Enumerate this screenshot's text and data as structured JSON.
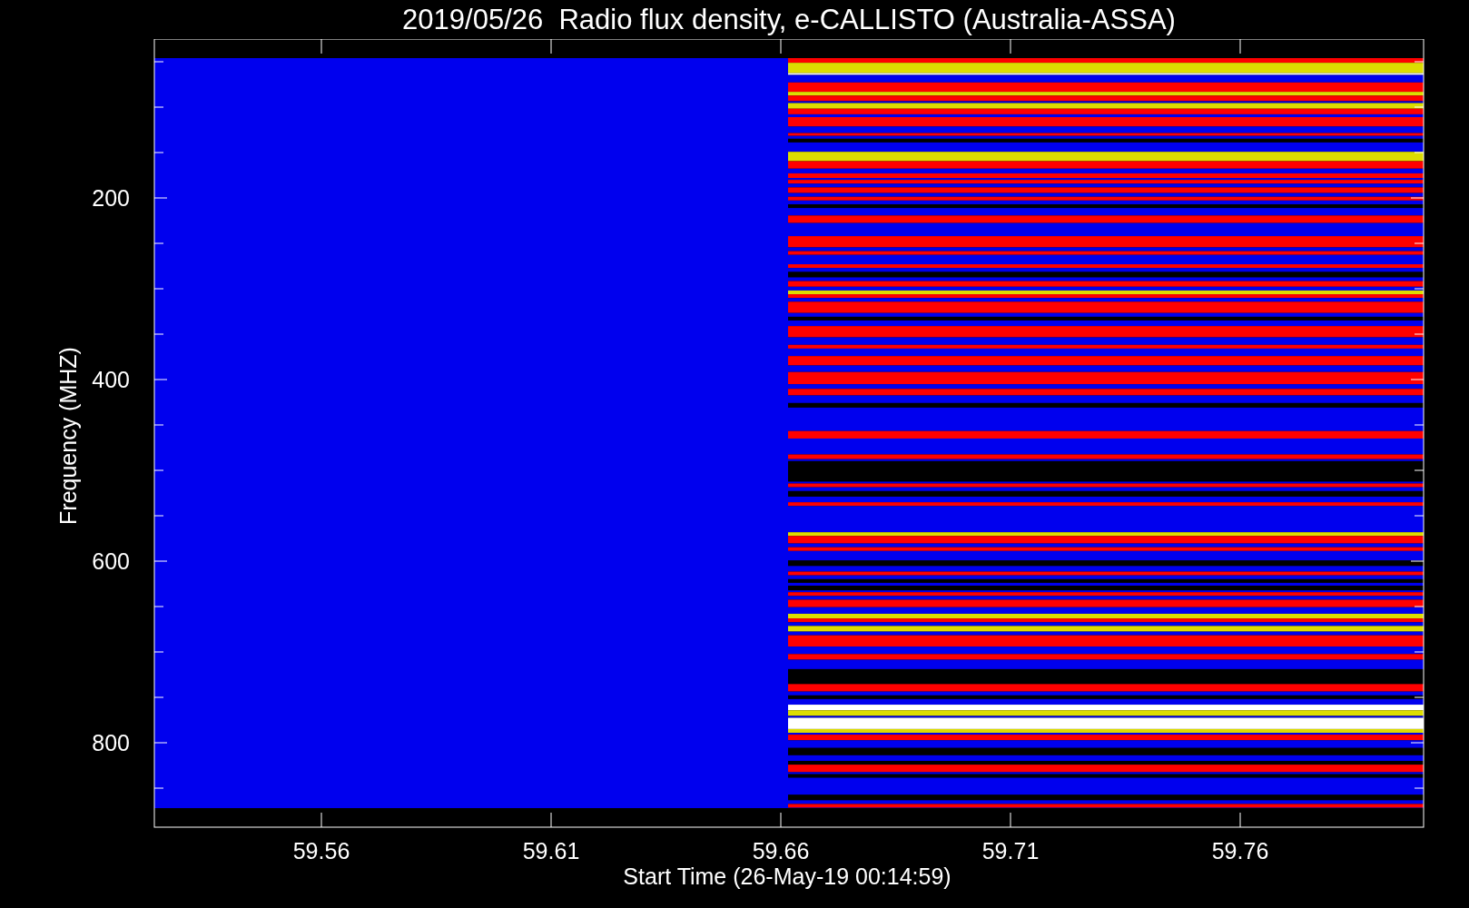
{
  "plot": {
    "title": "2019/05/26  Radio flux density, e-CALLISTO (Australia-ASSA)",
    "y_axis": {
      "label": "Frequency (MHZ)",
      "ticks": [
        "200",
        "400",
        "600",
        "800"
      ]
    },
    "x_axis": {
      "label": "Start Time (26-May-19 00:14:59)",
      "ticks": [
        "59.56",
        "59.61",
        "59.66",
        "59.71",
        "59.76"
      ]
    }
  }
}
